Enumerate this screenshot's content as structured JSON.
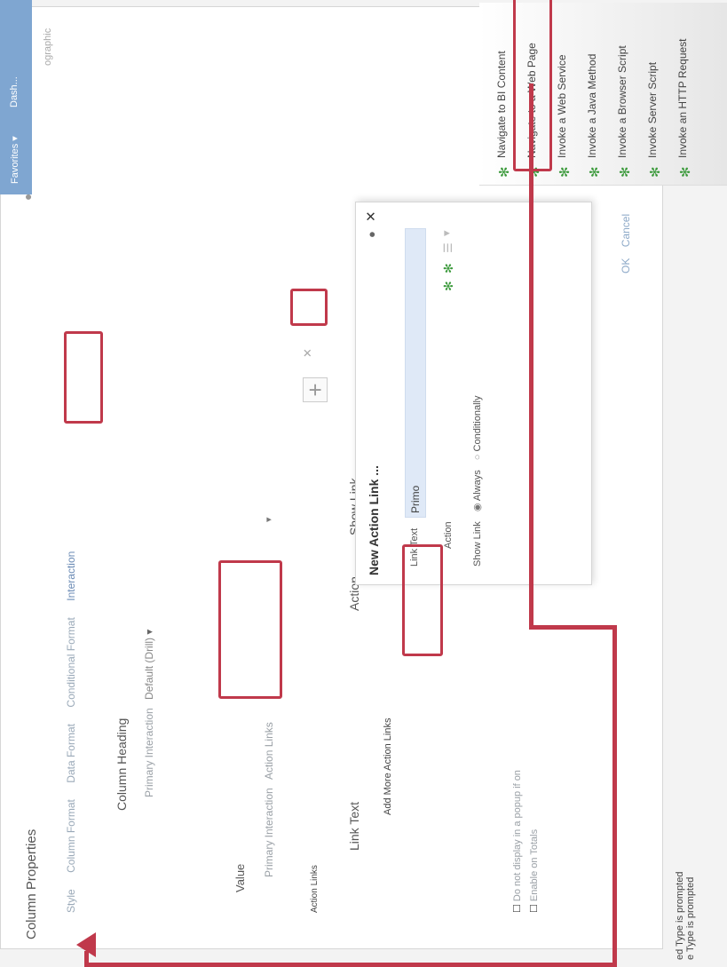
{
  "bg_left_labels": [
    "ed Type is prompted",
    "e Type is prompted"
  ],
  "column_properties": {
    "title": "Column Properties",
    "tabs": [
      "Style",
      "Column Format",
      "Data Format",
      "Conditional Format",
      "Interaction"
    ],
    "column_heading_label": "Column Heading",
    "primary_interaction_label": "Primary Interaction",
    "primary_interaction_value": "Default (Drill)",
    "value_label": "Value",
    "value_primary_interaction_label": "Primary Interaction",
    "value_primary_interaction_value": "Action Links",
    "action_links_label": "Action Links",
    "table_headers": [
      "Link Text",
      "Action",
      "Show Link"
    ],
    "add_more_label": "Add More Action Links",
    "checkbox_popup_label": "Do not display in a popup if on",
    "checkbox_totals_label": "Enable on Totals",
    "ok_label": "OK",
    "cancel_label": "Cancel"
  },
  "new_action_link": {
    "title": "New Action Link ...",
    "link_text_label": "Link Text",
    "link_text_value": "Primo",
    "action_label": "Action",
    "show_link_label": "Show Link",
    "option_always": "Always",
    "option_conditionally": "Conditionally"
  },
  "top_bar": {
    "favorites_label": "Favorites ▾",
    "dashboards_label": "Dash..."
  },
  "right_edge_text": "ographic",
  "action_menu": [
    "Navigate to BI Content",
    "Navigate to a Web Page",
    "Invoke a Web Service",
    "Invoke a Java Method",
    "Invoke a Browser Script",
    "Invoke Server Script",
    "Invoke an HTTP Request"
  ],
  "colors": {
    "highlight": "#c0394b",
    "accent": "#7fa6d1",
    "icon_green": "#3c9a3c"
  }
}
